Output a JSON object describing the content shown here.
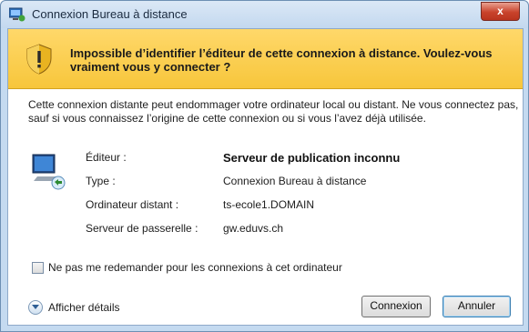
{
  "window": {
    "title": "Connexion Bureau à distance",
    "close_glyph": "x",
    "icons": {
      "title": "remote-desktop-icon",
      "close": "close-icon"
    }
  },
  "warning": {
    "icon": "shield-warning-icon",
    "message": "Impossible d’identifier l’éditeur de cette connexion à distance. Voulez-vous vraiment vous y connecter ?"
  },
  "description": "Cette connexion distante peut endommager votre ordinateur local ou distant. Ne vous connectez pas, sauf si vous connaissez l’origine de cette connexion ou si vous l’avez déjà utilisée.",
  "details": {
    "icon": "remote-computer-icon",
    "rows": [
      {
        "label": "Éditeur :",
        "value": "Serveur de publication inconnu"
      },
      {
        "label": "Type :",
        "value": "Connexion Bureau à distance"
      },
      {
        "label": "Ordinateur distant :",
        "value": "ts-ecole1.DOMAIN"
      },
      {
        "label": "Serveur de passerelle :",
        "value": "gw.eduvs.ch"
      }
    ]
  },
  "checkbox": {
    "label": "Ne pas me redemander pour les connexions à cet ordinateur",
    "checked": false
  },
  "footer": {
    "show_details": "Afficher détails",
    "connect_button": "Connexion",
    "cancel_button": "Annuler"
  }
}
